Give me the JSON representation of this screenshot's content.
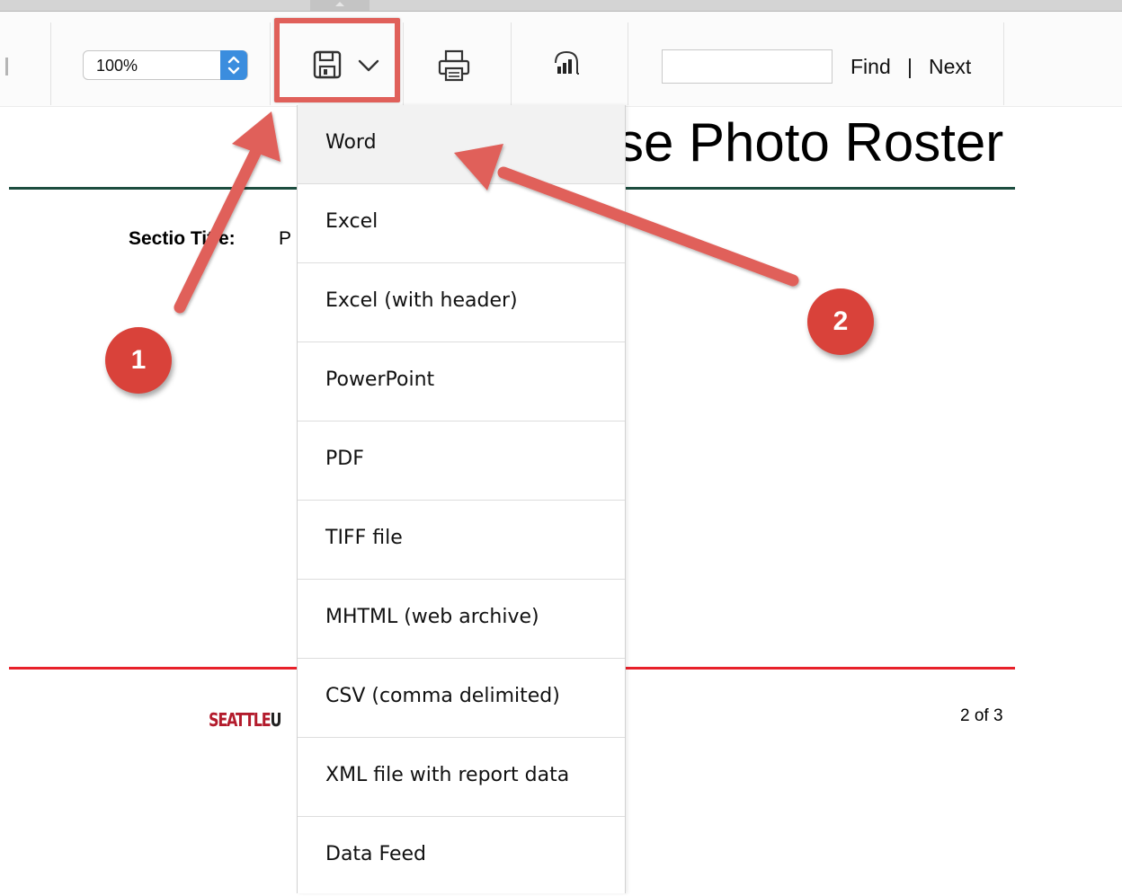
{
  "toolbar": {
    "zoom_value": "100%",
    "find_label": "Find",
    "find_separator": "|",
    "next_label": "Next",
    "find_input_value": ""
  },
  "report": {
    "title_visible": "se Photo Roster",
    "section_label": "Sectio Title:",
    "section_value": "P",
    "logo_red": "SEATTLE",
    "logo_dark": "U",
    "page_count": "2 of 3"
  },
  "export_menu": {
    "items": [
      {
        "label": "Word",
        "selected": true
      },
      {
        "label": "Excel"
      },
      {
        "label": "Excel (with header)"
      },
      {
        "label": "PowerPoint"
      },
      {
        "label": "PDF"
      },
      {
        "label": "TIFF file"
      },
      {
        "label": "MHTML (web archive)"
      },
      {
        "label": "CSV (comma delimited)"
      },
      {
        "label": "XML file with report data"
      },
      {
        "label": "Data Feed"
      }
    ]
  },
  "annotations": {
    "step_1": "1",
    "step_2": "2",
    "color": "#e0605a"
  },
  "colors": {
    "accent_blue": "#3b8dde",
    "title_rule": "#1d4d3f",
    "footer_rule": "#e8202a",
    "brand_red": "#b31b2c"
  },
  "icons": {
    "save": "save-icon",
    "chevron": "chevron-down-icon",
    "print": "print-icon",
    "powerbi": "power-bi-icon"
  }
}
